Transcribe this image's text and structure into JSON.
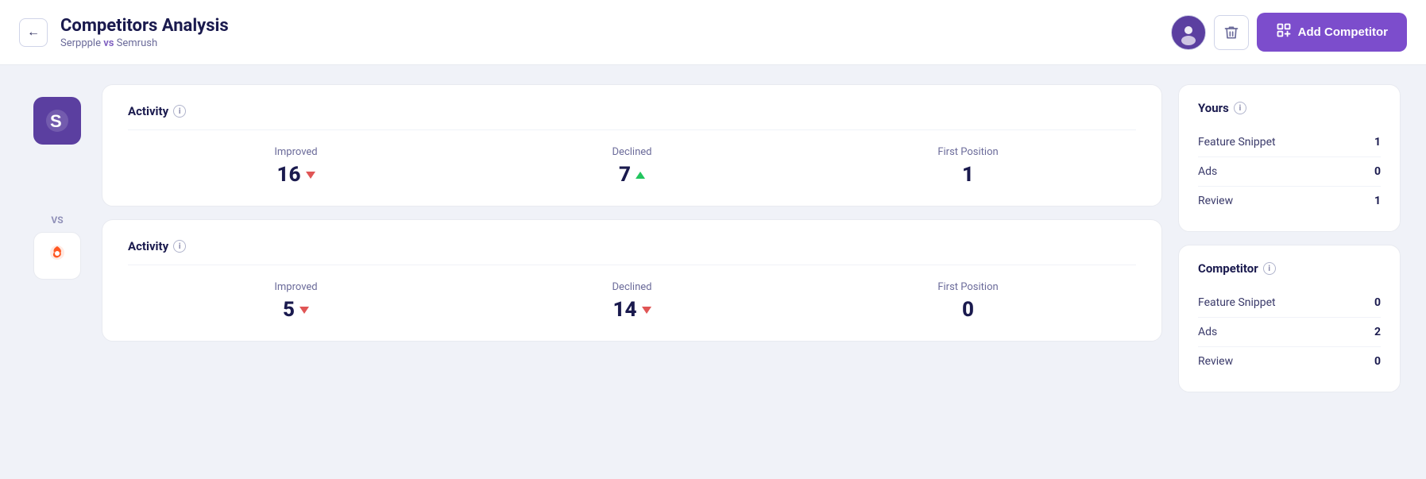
{
  "header": {
    "back_label": "←",
    "title": "Competitors Analysis",
    "subtitle_yours": "Serppple",
    "subtitle_vs": "vs",
    "subtitle_competitor": "Semrush",
    "add_competitor_label": "Add Competitor"
  },
  "brands": {
    "yours": {
      "name": "Serppple",
      "logo_icon": "⚡"
    },
    "vs_label": "VS",
    "competitor": {
      "name": "Semrush",
      "logo_icon": "🔥"
    }
  },
  "yours_activity": {
    "section_label": "Activity",
    "improved_label": "Improved",
    "improved_value": "16",
    "improved_trend": "down",
    "declined_label": "Declined",
    "declined_value": "7",
    "declined_trend": "up",
    "first_position_label": "First Position",
    "first_position_value": "1"
  },
  "competitor_activity": {
    "section_label": "Activity",
    "improved_label": "Improved",
    "improved_value": "5",
    "improved_trend": "down",
    "declined_label": "Declined",
    "declined_value": "14",
    "declined_trend": "down",
    "first_position_label": "First Position",
    "first_position_value": "0"
  },
  "yours_sidebar": {
    "title": "Yours",
    "rows": [
      {
        "label": "Feature Snippet",
        "value": "1"
      },
      {
        "label": "Ads",
        "value": "0"
      },
      {
        "label": "Review",
        "value": "1"
      }
    ]
  },
  "competitor_sidebar": {
    "title": "Competitor",
    "rows": [
      {
        "label": "Feature Snippet",
        "value": "0"
      },
      {
        "label": "Ads",
        "value": "2"
      },
      {
        "label": "Review",
        "value": "0"
      }
    ]
  }
}
